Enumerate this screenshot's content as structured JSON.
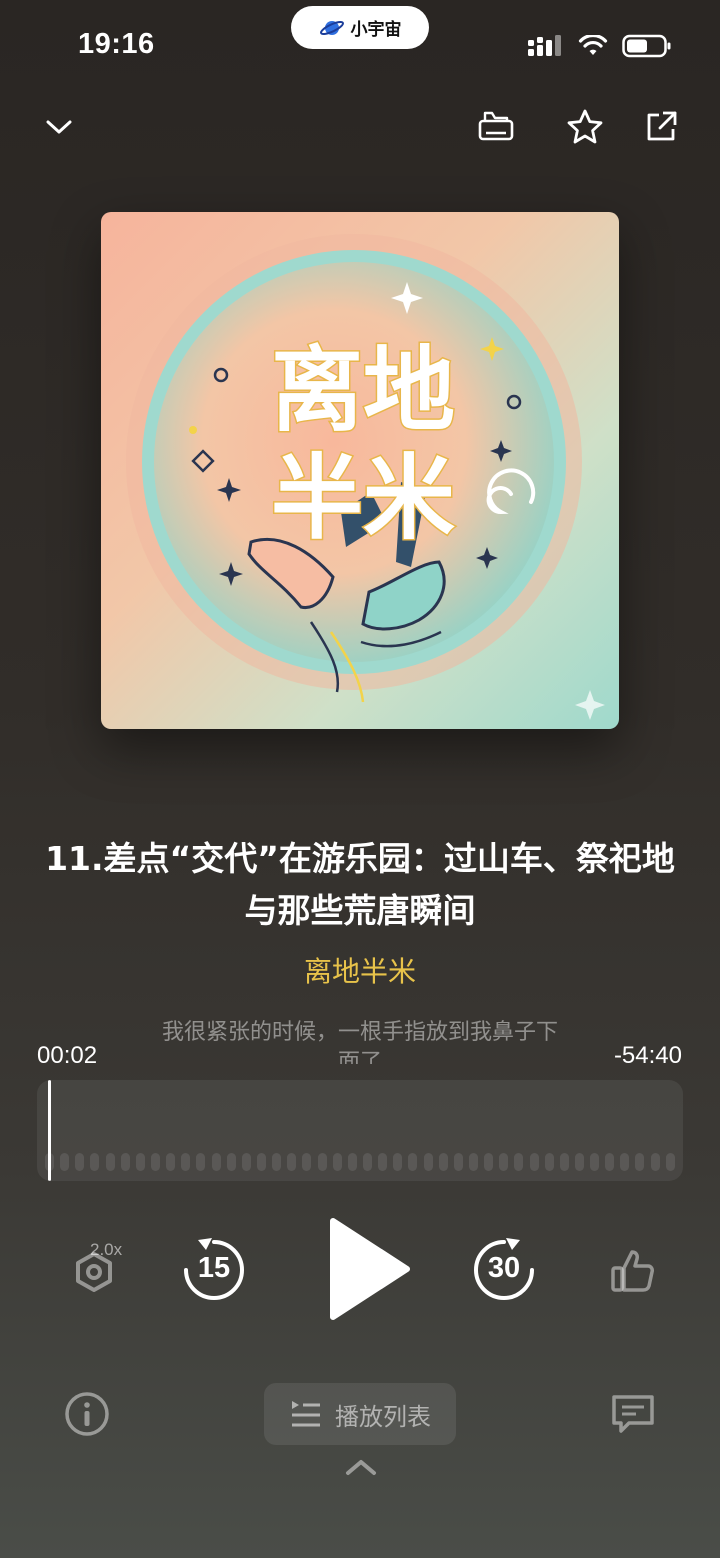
{
  "status_bar": {
    "time": "19:16",
    "pill_label": "小宇宙",
    "icons": [
      "signal-icon",
      "wifi-icon",
      "battery-icon"
    ]
  },
  "header": {
    "collapse_icon": "chevron-down-icon",
    "actions": [
      "podcast-tray-icon",
      "star-icon",
      "share-icon"
    ]
  },
  "cover": {
    "art_text": [
      "离地",
      "半米"
    ]
  },
  "episode": {
    "title": "11.差点“交代”在游乐园：过山车、祭祀地与那些荒唐瞬间",
    "podcast": "离地半米"
  },
  "lyric": {
    "line1": "我很紧张的时候，一根手指放到我鼻子下",
    "line2": "面了"
  },
  "progress": {
    "current": "00:02",
    "remaining": "-54:40"
  },
  "controls": {
    "speed": "2.0x",
    "rewind": "15",
    "forward": "30",
    "play_icon": "play-icon",
    "like_icon": "thumbs-up-icon"
  },
  "bottom": {
    "playlist_label": "播放列表",
    "info_icon": "info-icon",
    "comment_icon": "comment-icon",
    "expand_icon": "chevron-up-icon"
  },
  "colors": {
    "accent": "#e8c34a",
    "background": "#2e2a27"
  }
}
